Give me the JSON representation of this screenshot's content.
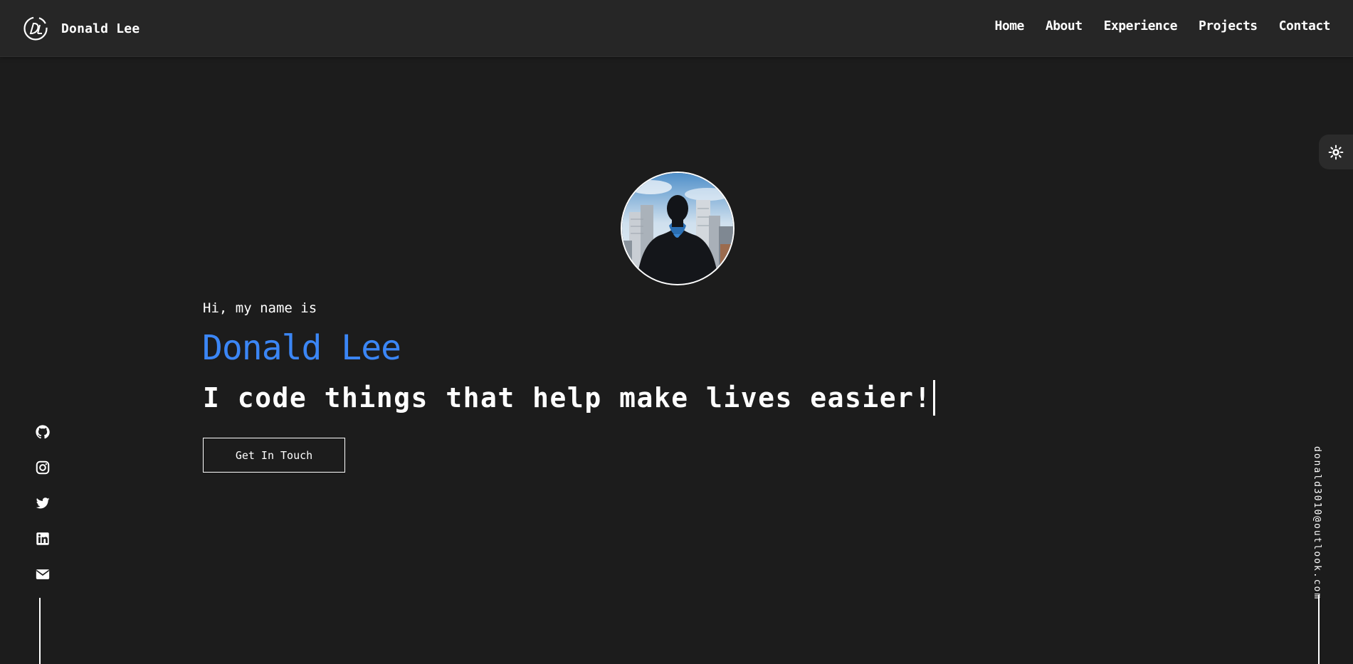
{
  "header": {
    "brand_name": "Donald Lee",
    "nav": [
      "Home",
      "About",
      "Experience",
      "Projects",
      "Contact"
    ]
  },
  "hero": {
    "greeting": "Hi, my name is",
    "name": "Donald Lee",
    "tagline": "I code things that help make lives easier!",
    "cta_label": "Get In Touch"
  },
  "social_icons": [
    "github-icon",
    "instagram-icon",
    "twitter-icon",
    "linkedin-icon",
    "envelope-icon"
  ],
  "theme_toggle_icon": "sun-icon",
  "email": "donald3010@outlook.com",
  "colors": {
    "background": "#1c1c1c",
    "header_bg": "#262626",
    "accent": "#3b86f5",
    "text": "#ffffff"
  }
}
